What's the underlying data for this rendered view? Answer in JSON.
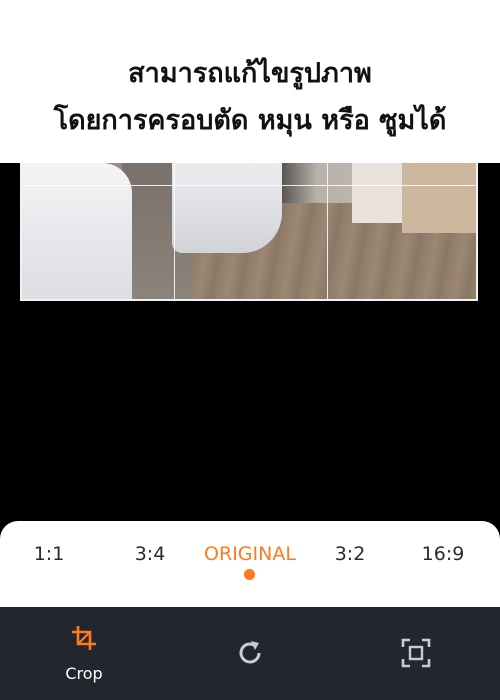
{
  "header": {
    "line1": "สามารถแก้ไขรูปภาพ",
    "line2": "โดยการครอบตัด หมุน หรือ ซูมได้"
  },
  "ratios": [
    {
      "label": "1:1",
      "active": false
    },
    {
      "label": "3:4",
      "active": false
    },
    {
      "label": "ORIGINAL",
      "active": true
    },
    {
      "label": "3:2",
      "active": false
    },
    {
      "label": "16:9",
      "active": false
    }
  ],
  "toolbar": {
    "crop_label": "Crop",
    "crop_icon": "crop-icon",
    "rotate_icon": "rotate-icon",
    "fit_icon": "fit-frame-icon"
  },
  "colors": {
    "accent": "#ff7a1f",
    "toolbar_bg": "#23262e",
    "icon_grey": "#c9ccd3"
  }
}
